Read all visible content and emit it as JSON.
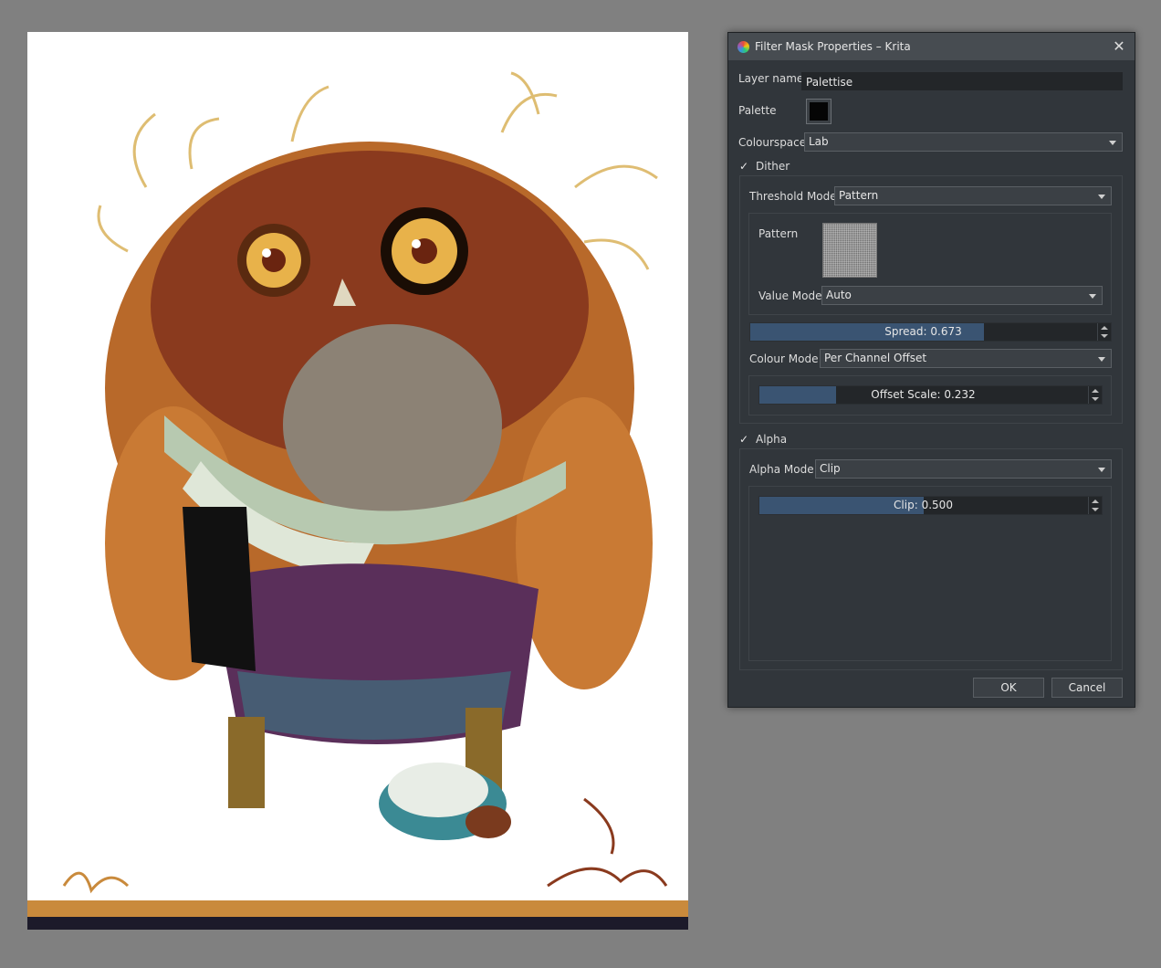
{
  "dialog": {
    "title": "Filter Mask Properties – Krita",
    "close_glyph": "✕",
    "layer_name_label": "Layer name:",
    "layer_name_value": "Palettise",
    "palette_label": "Palette",
    "colourspace_label": "Colourspace",
    "colourspace_value": "Lab",
    "dither_label": "Dither",
    "dither_checked": true,
    "threshold_mode_label": "Threshold Mode",
    "threshold_mode_value": "Pattern",
    "pattern_label": "Pattern",
    "value_mode_label": "Value Mode",
    "value_mode_value": "Auto",
    "spread_label": "Spread:",
    "spread_value": "0.673",
    "spread_fraction": 0.673,
    "colour_mode_label": "Colour Mode",
    "colour_mode_value": "Per Channel Offset",
    "offset_scale_label": "Offset Scale:",
    "offset_scale_value": "0.232",
    "offset_scale_fraction": 0.232,
    "alpha_label": "Alpha",
    "alpha_checked": true,
    "alpha_mode_label": "Alpha Mode",
    "alpha_mode_value": "Clip",
    "clip_label": "Clip:",
    "clip_value": "0.500",
    "clip_fraction": 0.5,
    "ok_label": "OK",
    "cancel_label": "Cancel",
    "check_glyph": "✓"
  },
  "canvas": {
    "background": "#ffffff",
    "accent_colors": [
      "#c98a3c",
      "#8a3a1e",
      "#5a2f5a",
      "#e8d58a",
      "#3a8a8a"
    ]
  }
}
